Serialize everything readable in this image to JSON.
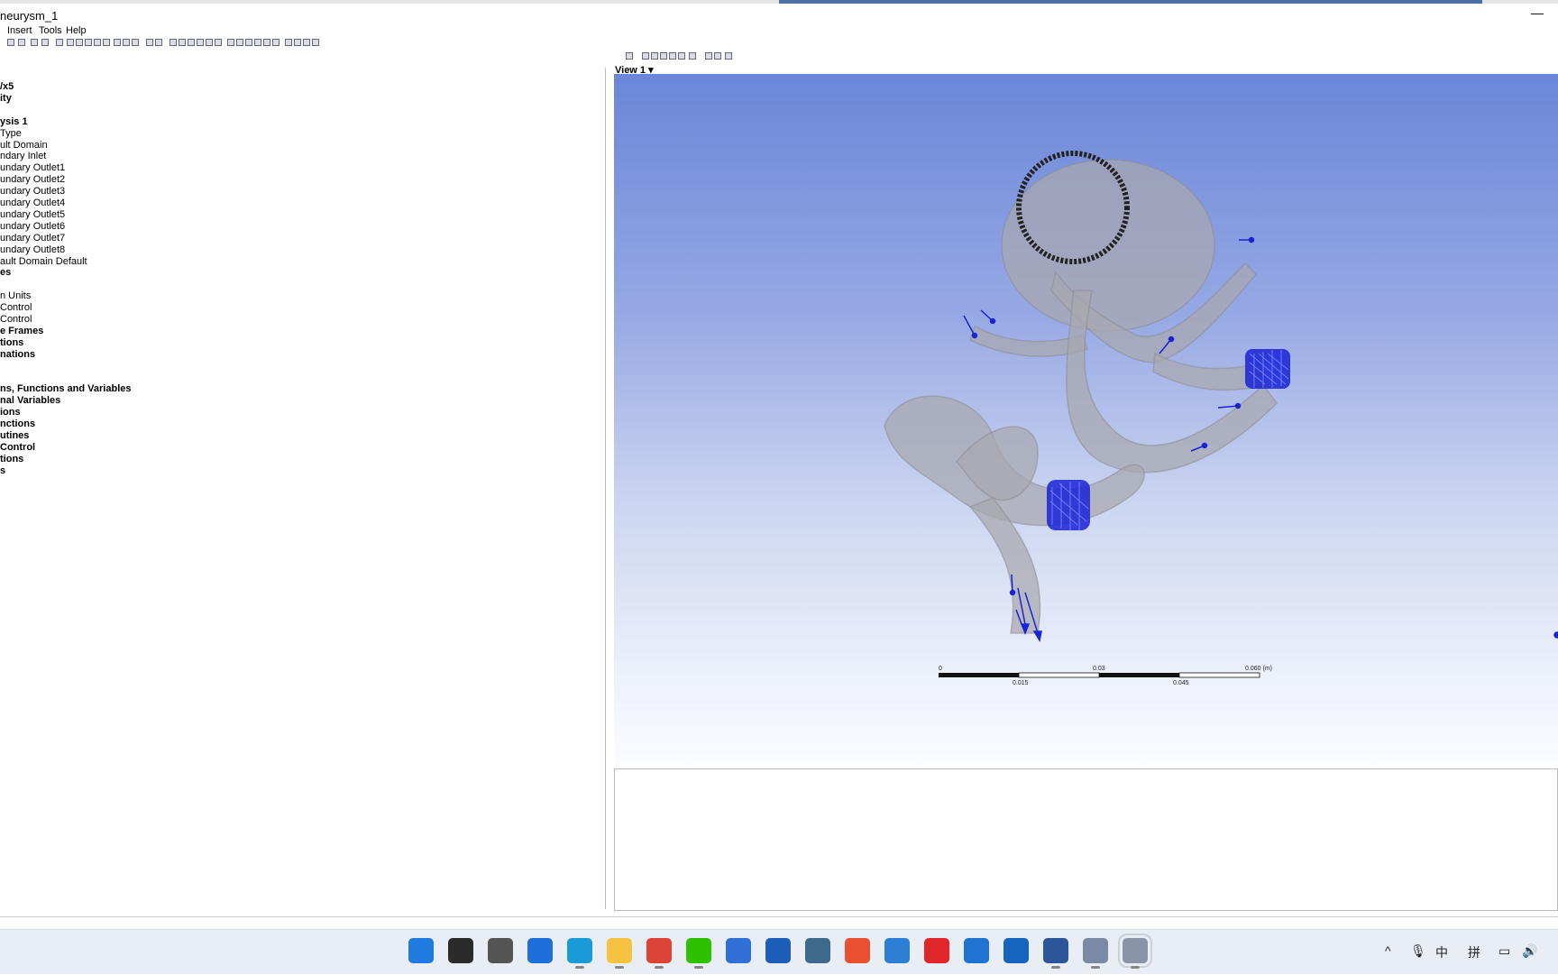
{
  "window": {
    "title": "neurysm_1",
    "minimize_glyph": "—"
  },
  "menu": {
    "items": [
      "Insert",
      "Tools",
      "Help"
    ]
  },
  "tree": {
    "rows": [
      {
        "text": "/x5",
        "bold": true
      },
      {
        "text": "ity",
        "bold": true
      },
      {
        "text": "",
        "bold": false
      },
      {
        "text": "ysis 1",
        "bold": true
      },
      {
        "text": "Type",
        "bold": false
      },
      {
        "text": "ult Domain",
        "bold": false
      },
      {
        "text": "ndary Inlet",
        "bold": false
      },
      {
        "text": "undary Outlet1",
        "bold": false
      },
      {
        "text": "undary Outlet2",
        "bold": false
      },
      {
        "text": "undary Outlet3",
        "bold": false
      },
      {
        "text": "undary Outlet4",
        "bold": false
      },
      {
        "text": "undary Outlet5",
        "bold": false
      },
      {
        "text": "undary Outlet6",
        "bold": false
      },
      {
        "text": "undary Outlet7",
        "bold": false
      },
      {
        "text": "undary Outlet8",
        "bold": false
      },
      {
        "text": "ault Domain Default",
        "bold": false
      },
      {
        "text": "es",
        "bold": true
      },
      {
        "text": "",
        "bold": false
      },
      {
        "text": "n Units",
        "bold": false
      },
      {
        "text": "Control",
        "bold": false
      },
      {
        "text": "Control",
        "bold": false
      },
      {
        "text": "e Frames",
        "bold": true
      },
      {
        "text": "tions",
        "bold": true
      },
      {
        "text": "nations",
        "bold": true
      },
      {
        "text": "",
        "bold": false
      },
      {
        "text": "",
        "bold": false
      },
      {
        "text": "ns, Functions and Variables",
        "bold": true
      },
      {
        "text": "nal Variables",
        "bold": true
      },
      {
        "text": "ions",
        "bold": true
      },
      {
        "text": "nctions",
        "bold": true
      },
      {
        "text": "utines",
        "bold": true
      },
      {
        "text": "Control",
        "bold": true
      },
      {
        "text": "tions",
        "bold": true
      },
      {
        "text": "s",
        "bold": true
      }
    ]
  },
  "viewer": {
    "label": "View 1",
    "dropdown_glyph": "▾",
    "scale_ticks_top": [
      "0",
      "0.03",
      "0.060 (m)"
    ],
    "scale_ticks_bottom": [
      "0.015",
      "0.045"
    ]
  },
  "taskbar": {
    "apps": [
      {
        "icon": "windows-start-icon",
        "color": "#1f7be0"
      },
      {
        "icon": "search-icon",
        "color": "#2b2b2b"
      },
      {
        "icon": "task-view-icon",
        "color": "#555555"
      },
      {
        "icon": "widgets-icon",
        "color": "#1e6fd9"
      },
      {
        "icon": "edge-icon",
        "color": "#1a9bd7"
      },
      {
        "icon": "file-explorer-icon",
        "color": "#f5c242"
      },
      {
        "icon": "chrome-icon",
        "color": "#db4437"
      },
      {
        "icon": "wechat-icon",
        "color": "#2dc100"
      },
      {
        "icon": "app-blue-stripes-icon",
        "color": "#2f6fd6"
      },
      {
        "icon": "app-shield-icon",
        "color": "#1d5fb8"
      },
      {
        "icon": "photos-icon",
        "color": "#3d6a8c"
      },
      {
        "icon": "app-red-x-icon",
        "color": "#e8502f"
      },
      {
        "icon": "notepad-icon",
        "color": "#2d7fd6"
      },
      {
        "icon": "netease-music-icon",
        "color": "#e0262b"
      },
      {
        "icon": "mail-icon",
        "color": "#1f73d1"
      },
      {
        "icon": "app-mountain-icon",
        "color": "#1565c0"
      },
      {
        "icon": "word-icon",
        "color": "#2b579a"
      },
      {
        "icon": "app-grey-circle-icon",
        "color": "#7a8aa6"
      },
      {
        "icon": "ansys-cfx-icon",
        "color": "#8a94a8"
      }
    ],
    "tray": [
      "^",
      "mic",
      "中",
      "拼",
      "screen",
      "vol"
    ]
  },
  "colors": {
    "viewport_top": "#6b86d9",
    "viewport_bottom": "#fbfcff",
    "vessel": "#a8a8ae",
    "boundary_blue": "#1a22d6"
  }
}
